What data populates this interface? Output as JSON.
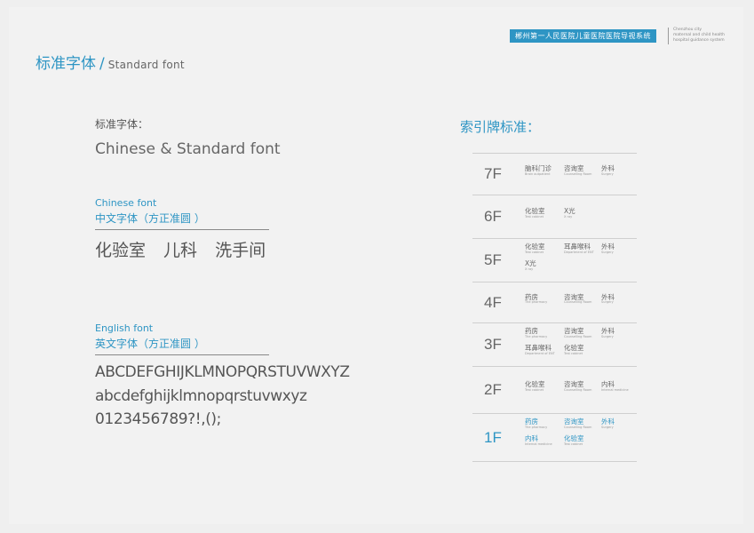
{
  "header": {
    "badge": "郴州第一人民医院儿童医院医院导视系统",
    "en_lines": [
      "Chenzhou city",
      "maternal and child health",
      "hospital guidance system"
    ]
  },
  "title": {
    "zh": "标准字体",
    "slash": "/",
    "en": "Standard font"
  },
  "left": {
    "label": "标准字体：",
    "heading": "Chinese & Standard font",
    "chinese_section": {
      "en": "Chinese font",
      "zh": "中文字体（方正准圆 ）",
      "sample": "化验室 儿科 洗手间"
    },
    "english_section": {
      "en": "English font",
      "zh": "英文字体（方正准圆 ）",
      "lines": [
        "ABCDEFGHIJKLMNOPQRSTUVWXYZ",
        "abcdefghijklmnopqrstuvwxyz",
        "0123456789?!,();"
      ]
    }
  },
  "right": {
    "title": "索引牌标准：",
    "rows": [
      {
        "floor": "7F",
        "items": [
          {
            "zh": "脑科门诊",
            "en": "Brain outpatient"
          },
          {
            "zh": "咨询室",
            "en": "Counselling Room"
          },
          {
            "zh": "外科",
            "en": "Surgery"
          }
        ]
      },
      {
        "floor": "6F",
        "items": [
          {
            "zh": "化验室",
            "en": "Test cabinet"
          },
          {
            "zh": "X光",
            "en": "X ray"
          }
        ]
      },
      {
        "floor": "5F",
        "items": [
          {
            "zh": "化验室",
            "en": "Test cabinet"
          },
          {
            "zh": "耳鼻喉科",
            "en": "Department of ENT"
          },
          {
            "zh": "外科",
            "en": "Surgery"
          },
          {
            "zh": "X光",
            "en": "X ray"
          }
        ]
      },
      {
        "floor": "4F",
        "items": [
          {
            "zh": "药房",
            "en": "The pharmacy"
          },
          {
            "zh": "咨询室",
            "en": "Counselling Room"
          },
          {
            "zh": "外科",
            "en": "Surgery"
          }
        ]
      },
      {
        "floor": "3F",
        "items": [
          {
            "zh": "药房",
            "en": "The pharmacy"
          },
          {
            "zh": "咨询室",
            "en": "Counselling Room"
          },
          {
            "zh": "外科",
            "en": "Surgery"
          },
          {
            "zh": "耳鼻喉科",
            "en": "Department of ENT"
          },
          {
            "zh": "化验室",
            "en": "Test cabinet"
          }
        ]
      },
      {
        "floor": "2F",
        "items": [
          {
            "zh": "化验室",
            "en": "Test cabinet"
          },
          {
            "zh": "咨询室",
            "en": "Counselling Room"
          },
          {
            "zh": "内科",
            "en": "Internal medicine"
          }
        ]
      },
      {
        "floor": "1F",
        "active": true,
        "items": [
          {
            "zh": "药房",
            "en": "The pharmacy"
          },
          {
            "zh": "咨询室",
            "en": "Counselling Room"
          },
          {
            "zh": "外科",
            "en": "Surgery"
          },
          {
            "zh": "内科",
            "en": "Internal medicine"
          },
          {
            "zh": "化验室",
            "en": "Test cabinet"
          }
        ]
      }
    ]
  },
  "colors": {
    "accent": "#2e95c4",
    "text": "#555555",
    "background": "#f2f2f2"
  }
}
